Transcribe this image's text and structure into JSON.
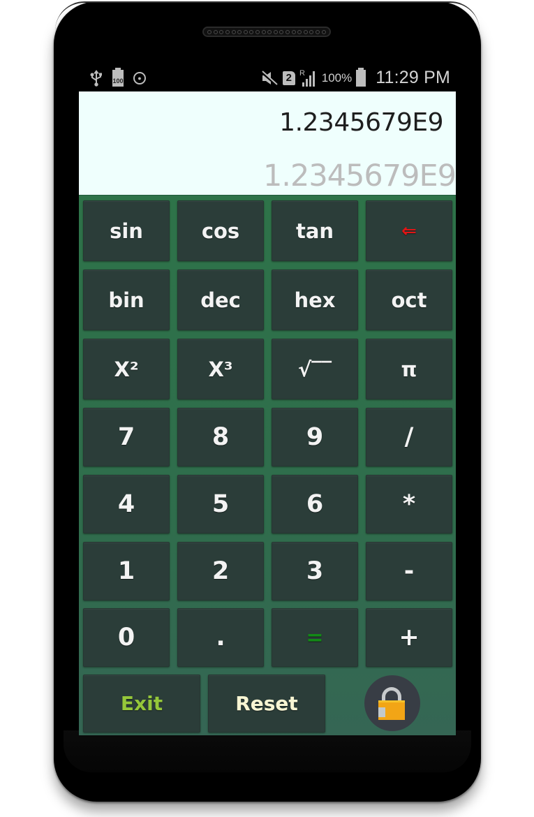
{
  "status_bar": {
    "left_icons": [
      "usb-icon",
      "battery-100-icon",
      "shield-icon"
    ],
    "battery_small_label": "100",
    "right_icons": [
      "mute-icon",
      "sim-2-icon",
      "signal-roaming-icon",
      "battery-icon"
    ],
    "sim_label": "2",
    "roaming_label": "R",
    "battery_percent": "100%",
    "time": "11:29 PM"
  },
  "display": {
    "expression": "1.2345679E9",
    "result": "1.2345679E9"
  },
  "colors": {
    "keypad_bg": "#2e7349",
    "key_bg": "#2b3d39",
    "display_bg": "#effffd",
    "backspace": "#e01515",
    "equals": "#138a17",
    "exit": "#95c73a",
    "reset": "#f7f5d3",
    "lock_body": "#f2a516"
  },
  "keys": {
    "r0": [
      "sin",
      "cos",
      "tan",
      "⇐"
    ],
    "r1": [
      "bin",
      "dec",
      "hex",
      "oct"
    ],
    "r2": [
      "X²",
      "X³",
      "√‾‾",
      "π"
    ],
    "r3": [
      "7",
      "8",
      "9",
      "/"
    ],
    "r4": [
      "4",
      "5",
      "6",
      "*"
    ],
    "r5": [
      "1",
      "2",
      "3",
      "-"
    ],
    "r6": [
      "0",
      ".",
      "=",
      "+"
    ]
  },
  "bottom": {
    "exit_label": "Exit",
    "reset_label": "Reset",
    "lock_icon": "padlock-icon"
  }
}
